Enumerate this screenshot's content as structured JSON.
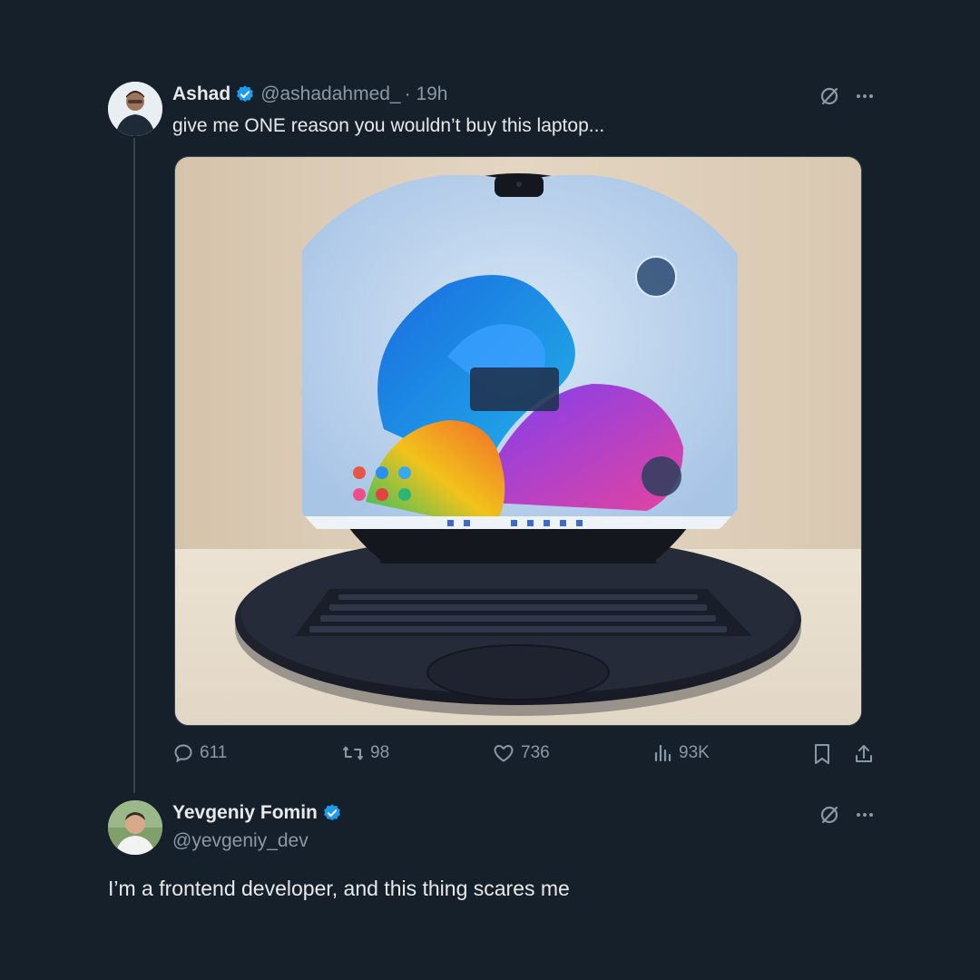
{
  "tweet": {
    "author_name": "Ashad",
    "handle": "@ashadahmed_",
    "time": "· 19h",
    "text": "give me ONE reason you wouldn’t buy this laptop...",
    "stats": {
      "replies": "611",
      "retweets": "98",
      "likes": "736",
      "views": "93K"
    }
  },
  "reply": {
    "author_name": "Yevgeniy Fomin",
    "handle": "@yevgeniy_dev",
    "text": "I’m a frontend developer, and this thing scares me"
  },
  "colors": {
    "background": "#15202b",
    "verified": "#1d9bf0",
    "muted": "#8b98a5"
  }
}
